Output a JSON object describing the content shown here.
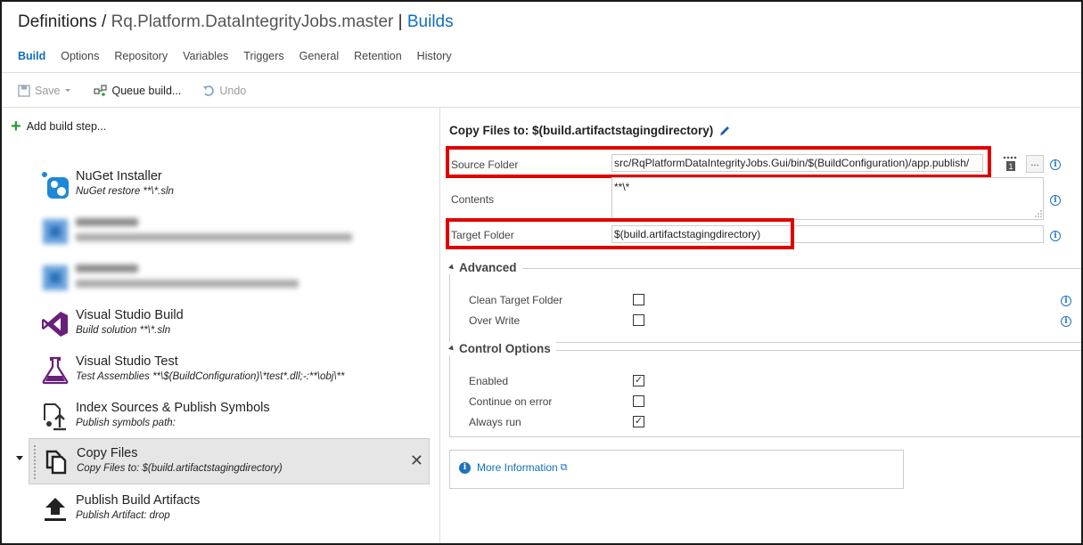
{
  "header": {
    "breadcrumb_root": "Definitions",
    "separator": "/",
    "definition_name": "Rq.Platform.DataIntegrityJobs.master",
    "pipe": "|",
    "builds_link": "Builds"
  },
  "tabs": [
    {
      "label": "Build",
      "active": true
    },
    {
      "label": "Options"
    },
    {
      "label": "Repository"
    },
    {
      "label": "Variables"
    },
    {
      "label": "Triggers"
    },
    {
      "label": "General"
    },
    {
      "label": "Retention"
    },
    {
      "label": "History"
    }
  ],
  "toolbar": {
    "save_label": "Save",
    "queue_label": "Queue build...",
    "undo_label": "Undo"
  },
  "left_panel": {
    "add_step_label": "Add build step...",
    "steps": [
      {
        "name": "NuGet Installer",
        "desc": "NuGet restore **\\*.sln",
        "icon": "nuget-icon"
      },
      {
        "name": "",
        "desc": "",
        "icon": "blurred-icon"
      },
      {
        "name": "",
        "desc": "",
        "icon": "blurred-icon"
      },
      {
        "name": "Visual Studio Build",
        "desc": "Build solution **\\*.sln",
        "icon": "visual-studio-icon"
      },
      {
        "name": "Visual Studio Test",
        "desc": "Test Assemblies **\\$(BuildConfiguration)\\*test*.dll;-:**\\obj\\**",
        "icon": "flask-icon"
      },
      {
        "name": "Index Sources & Publish Symbols",
        "desc": "Publish symbols path:",
        "icon": "publish-symbols-icon"
      },
      {
        "name": "Copy Files",
        "desc": "Copy Files to: $(build.artifactstagingdirectory)",
        "icon": "copy-files-icon",
        "selected": true
      },
      {
        "name": "Publish Build Artifacts",
        "desc": "Publish Artifact: drop",
        "icon": "upload-icon"
      }
    ],
    "close_glyph": "✕"
  },
  "task": {
    "title": "Copy Files to: $(build.artifactstagingdirectory)",
    "source_folder_label": "Source Folder",
    "source_folder_value": "src/RqPlatformDataIntegrityJobs.Gui/bin/$(BuildConfiguration)/app.publish/",
    "contents_label": "Contents",
    "contents_value": "**\\*",
    "target_folder_label": "Target Folder",
    "target_folder_value": "$(build.artifactstagingdirectory)",
    "browse_label": "...",
    "info_glyph": "i"
  },
  "advanced": {
    "title": "Advanced",
    "options": [
      {
        "label": "Clean Target Folder",
        "checked": false
      },
      {
        "label": "Over Write",
        "checked": false
      }
    ]
  },
  "control_options": {
    "title": "Control Options",
    "options": [
      {
        "label": "Enabled",
        "checked": true
      },
      {
        "label": "Continue on error",
        "checked": false
      },
      {
        "label": "Always run",
        "checked": true
      }
    ]
  },
  "more_information": {
    "label": "More Information",
    "link_glyph": "⧉"
  },
  "colors": {
    "accent": "#106ebe",
    "highlight_box": "#e00000",
    "add_plus": "#2d9a2d"
  }
}
